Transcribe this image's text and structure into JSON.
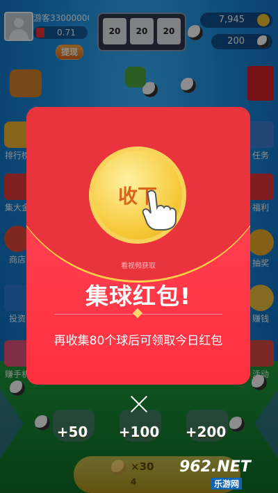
{
  "user": {
    "name": "游客33000000",
    "balance": "0.71",
    "withdraw_label": "提现"
  },
  "slots": [
    "20",
    "20",
    "20"
  ],
  "counters": [
    {
      "value": "7,945"
    },
    {
      "value": "200"
    }
  ],
  "side_left": [
    "排行榜",
    "集大金",
    "商店",
    "投资",
    "赚手机"
  ],
  "side_right": [
    "任务",
    "福利",
    "抽奖",
    "赚钱",
    "活动"
  ],
  "popup": {
    "coin_text": "收下",
    "video_tip": "看视频获取",
    "title": "集球红包!",
    "subtitle": "再收集80个球后可领取今日红包"
  },
  "bottom": {
    "bonuses": [
      "+50",
      "+100",
      "+200"
    ],
    "button_label": "×30",
    "button_sub": "4"
  },
  "watermark": {
    "logo": "962.NET",
    "text": "乐游网"
  },
  "colors": {
    "popup": "#ff3a48",
    "coin": "#f6c93a",
    "accent": "#ffce4a"
  }
}
